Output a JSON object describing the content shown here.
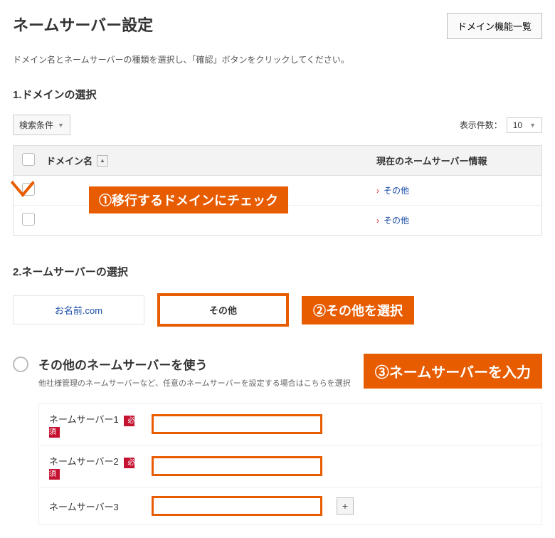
{
  "header": {
    "title": "ネームサーバー設定",
    "button_label": "ドメイン機能一覧"
  },
  "description": "ドメイン名とネームサーバーの種類を選択し、「確認」ボタンをクリックしてください。",
  "section1": {
    "title": "1.ドメインの選択",
    "filter_label": "検索条件",
    "pagesize_label": "表示件数：",
    "pagesize_value": "10",
    "th_domain": "ドメイン名",
    "th_ns": "現在のネームサーバー情報",
    "rows": [
      {
        "checked": true,
        "ns_text": "その他"
      },
      {
        "checked": false,
        "ns_text": "その他"
      }
    ],
    "callout1": "①移行するドメインにチェック"
  },
  "section2": {
    "title": "2.ネームサーバーの選択",
    "tab_onamae": "お名前.com",
    "tab_other": "その他",
    "callout2": "②その他を選択",
    "radio_label": "その他のネームサーバーを使う",
    "radio_desc": "他社様管理のネームサーバーなど、任意のネームサーバーを設定する場合はこちらを選択",
    "callout3": "③ネームサーバーを入力",
    "fields": [
      {
        "label": "ネームサーバー1",
        "required": true
      },
      {
        "label": "ネームサーバー2",
        "required": true
      },
      {
        "label": "ネームサーバー3",
        "required": false
      }
    ],
    "required_text": "必須"
  }
}
